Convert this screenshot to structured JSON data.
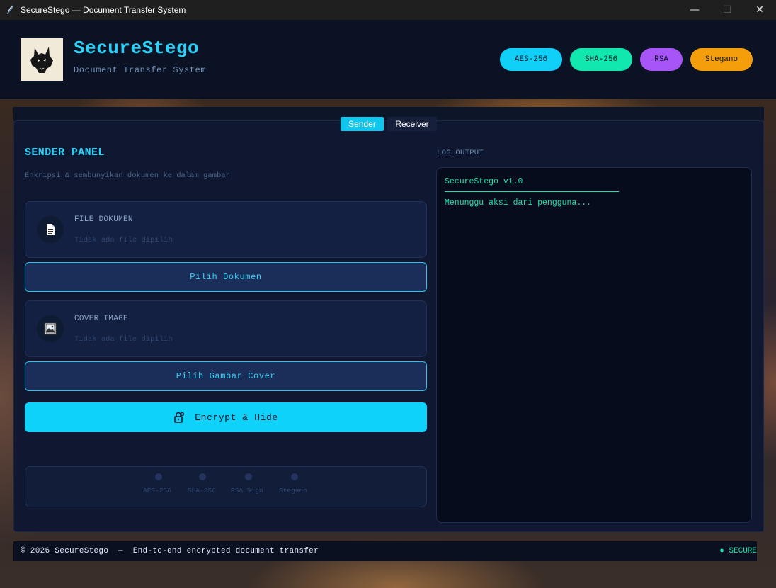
{
  "window": {
    "title": "SecureStego — Document Transfer System",
    "controls": {
      "minimize": "—",
      "maximize": "☐",
      "close": "✕"
    }
  },
  "header": {
    "title": "SecureStego",
    "subtitle": "Document Transfer System",
    "badges": [
      {
        "label": "AES-256",
        "color": "#10d0f8"
      },
      {
        "label": "SHA-256",
        "color": "#10e8b0"
      },
      {
        "label": "RSA",
        "color": "#a855f7"
      },
      {
        "label": "Stegano",
        "color": "#f59e0b"
      }
    ]
  },
  "tabs": [
    {
      "label": "Sender",
      "active": true
    },
    {
      "label": "Receiver",
      "active": false
    }
  ],
  "sender": {
    "title": "SENDER PANEL",
    "subtitle": "Enkripsi & sembunyikan dokumen ke dalam gambar",
    "document": {
      "label": "FILE DOKUMEN",
      "status": "Tidak ada file dipilih",
      "icon": "document-icon"
    },
    "pick_document": "Pilih Dokumen",
    "cover": {
      "label": "COVER IMAGE",
      "status": "Tidak ada file dipilih",
      "icon": "image-icon"
    },
    "pick_cover": "Pilih Gambar Cover",
    "encrypt": {
      "label": "Encrypt & Hide",
      "icon": "lock-key-icon"
    },
    "steps": [
      "AES-256",
      "SHA-256",
      "RSA Sign",
      "Stegano"
    ]
  },
  "log": {
    "title": "LOG OUTPUT",
    "header": "SecureStego v1.0",
    "message": "Menunggu aksi dari pengguna..."
  },
  "footer": {
    "text": "© 2026 SecureStego  —  End-to-end encrypted document transfer",
    "status": "● SECURE"
  }
}
